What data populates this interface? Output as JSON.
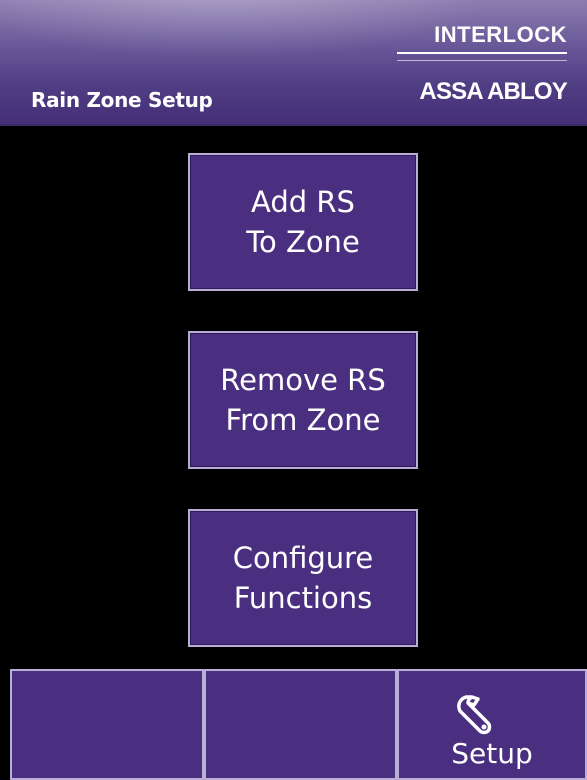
{
  "header": {
    "title": "Rain Zone Setup",
    "logo_top": "INTERLOCK",
    "logo_bottom": "ASSA ABLOY"
  },
  "actions": [
    {
      "line1": "Add RS",
      "line2": "To Zone"
    },
    {
      "line1": "Remove RS",
      "line2": "From Zone"
    },
    {
      "line1": "Configure",
      "line2": "Functions"
    }
  ],
  "nav": {
    "items": [
      {
        "label": "",
        "icon": ""
      },
      {
        "label": "",
        "icon": ""
      },
      {
        "label": "Setup",
        "icon": "wrench-icon"
      }
    ]
  },
  "colors": {
    "button_fill": "#4a2f80",
    "button_border": "#b9aed6",
    "header_top": "#8c7db0",
    "header_bottom": "#452f78",
    "background": "#000000"
  }
}
